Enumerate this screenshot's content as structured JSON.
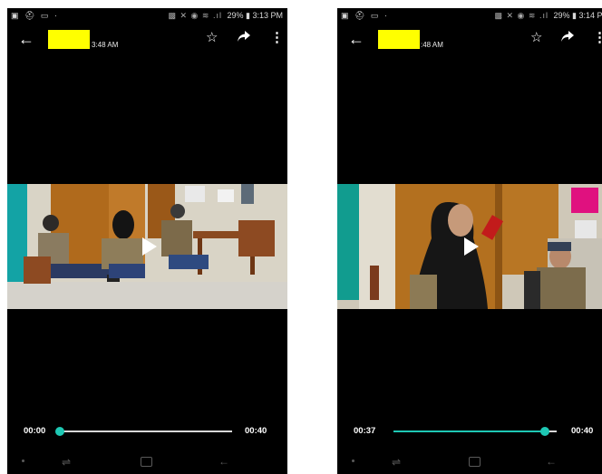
{
  "screens": [
    {
      "status": {
        "left_icons": "▣ ⛑ ▭ ·",
        "battery": "29%",
        "time": "3:13 PM"
      },
      "timestamp": "3:48 AM",
      "player": {
        "elapsed": "00:00",
        "duration": "00:40",
        "progress": 0.0
      },
      "icons": {
        "back": "back-arrow-icon",
        "star": "star-icon",
        "share": "share-icon",
        "menu": "overflow-menu-icon",
        "play": "play-icon"
      }
    },
    {
      "status": {
        "left_icons": "▣ ⛑ ▭ ·",
        "battery": "29%",
        "time": "3:14 PM"
      },
      "timestamp": ":48 AM",
      "player": {
        "elapsed": "00:37",
        "duration": "00:40",
        "progress": 0.925
      },
      "icons": {
        "back": "back-arrow-icon",
        "star": "star-icon",
        "share": "share-icon",
        "menu": "overflow-menu-icon",
        "play": "play-icon"
      }
    }
  ],
  "colors": {
    "accent": "#1ec8b4",
    "redaction": "#ffff00",
    "background": "#000000"
  }
}
